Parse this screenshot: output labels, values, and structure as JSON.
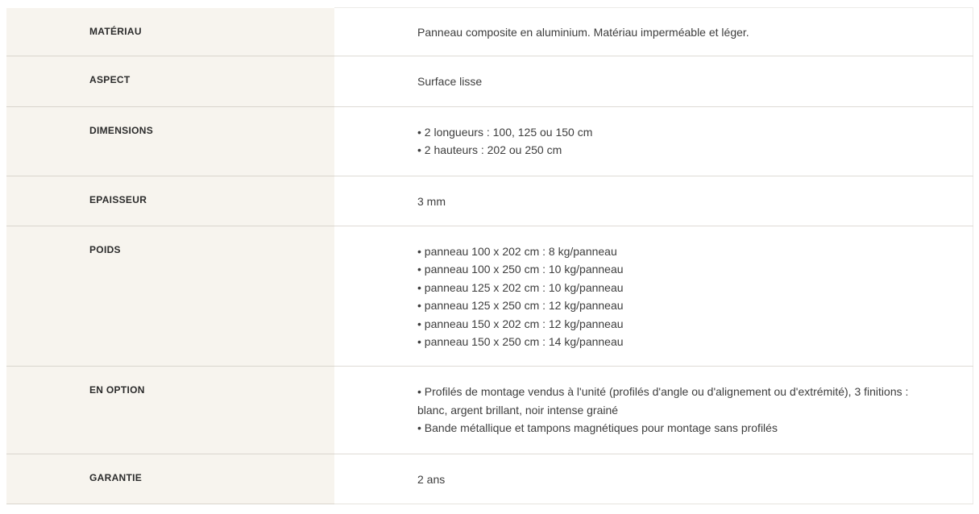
{
  "specs": {
    "rows": [
      {
        "label": "MATÉRIAU",
        "lines": [
          "Panneau composite en aluminium. Matériau imperméable et léger."
        ]
      },
      {
        "label": "ASPECT",
        "lines": [
          "Surface lisse"
        ]
      },
      {
        "label": "DIMENSIONS",
        "lines": [
          "• 2 longueurs : 100, 125 ou 150 cm",
          "• 2 hauteurs : 202 ou 250 cm"
        ]
      },
      {
        "label": "EPAISSEUR",
        "lines": [
          "3 mm"
        ]
      },
      {
        "label": "POIDS",
        "lines": [
          "• panneau 100 x 202 cm : 8 kg/panneau",
          "• panneau 100 x 250 cm : 10 kg/panneau",
          "• panneau 125 x 202 cm : 10 kg/panneau",
          "• panneau 125 x 250 cm : 12 kg/panneau",
          "• panneau 150 x 202 cm : 12 kg/panneau",
          "• panneau 150 x 250 cm : 14 kg/panneau"
        ]
      },
      {
        "label": "EN OPTION",
        "lines": [
          "• Profilés de montage vendus à l'unité (profilés d'angle ou d'alignement ou d'extrémité), 3 finitions :",
          "blanc, argent brillant, noir intense grainé",
          "• Bande métallique et tampons magnétiques pour montage sans profilés"
        ]
      },
      {
        "label": "GARANTIE",
        "lines": [
          "2 ans"
        ]
      }
    ]
  }
}
